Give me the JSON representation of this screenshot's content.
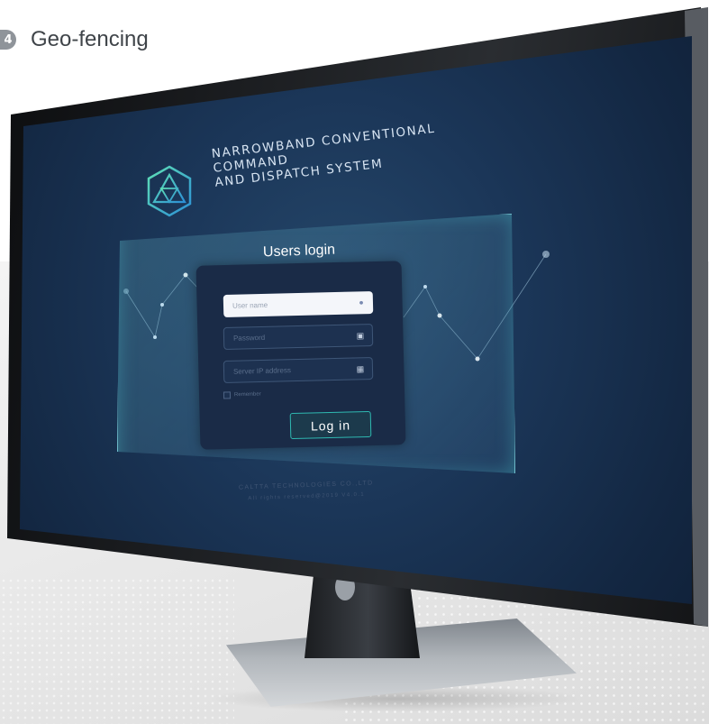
{
  "section": {
    "number": "4",
    "title": "Geo-fencing"
  },
  "screen": {
    "system_title_line1": "NARROWBAND CONVENTIONAL COMMAND",
    "system_title_line2": "AND DISPATCH SYSTEM",
    "login_title": "Users login",
    "username_placeholder": "User name",
    "password_placeholder": "Password",
    "server_placeholder": "Server IP address",
    "remember_label": "Remember",
    "login_button": "Log in",
    "company": "CALTTA TECHNOLOGIES CO.,LTD",
    "copyright": "All rights reserved@2019 V4.0.1"
  },
  "icons": {
    "logo": "triangle-hexagon-logo",
    "username": "user-icon",
    "password": "lock-icon",
    "server": "server-icon"
  },
  "colors": {
    "accent": "#2fb9b1",
    "screen_bg": "#1b3658",
    "panel_border": "#96dceb"
  }
}
